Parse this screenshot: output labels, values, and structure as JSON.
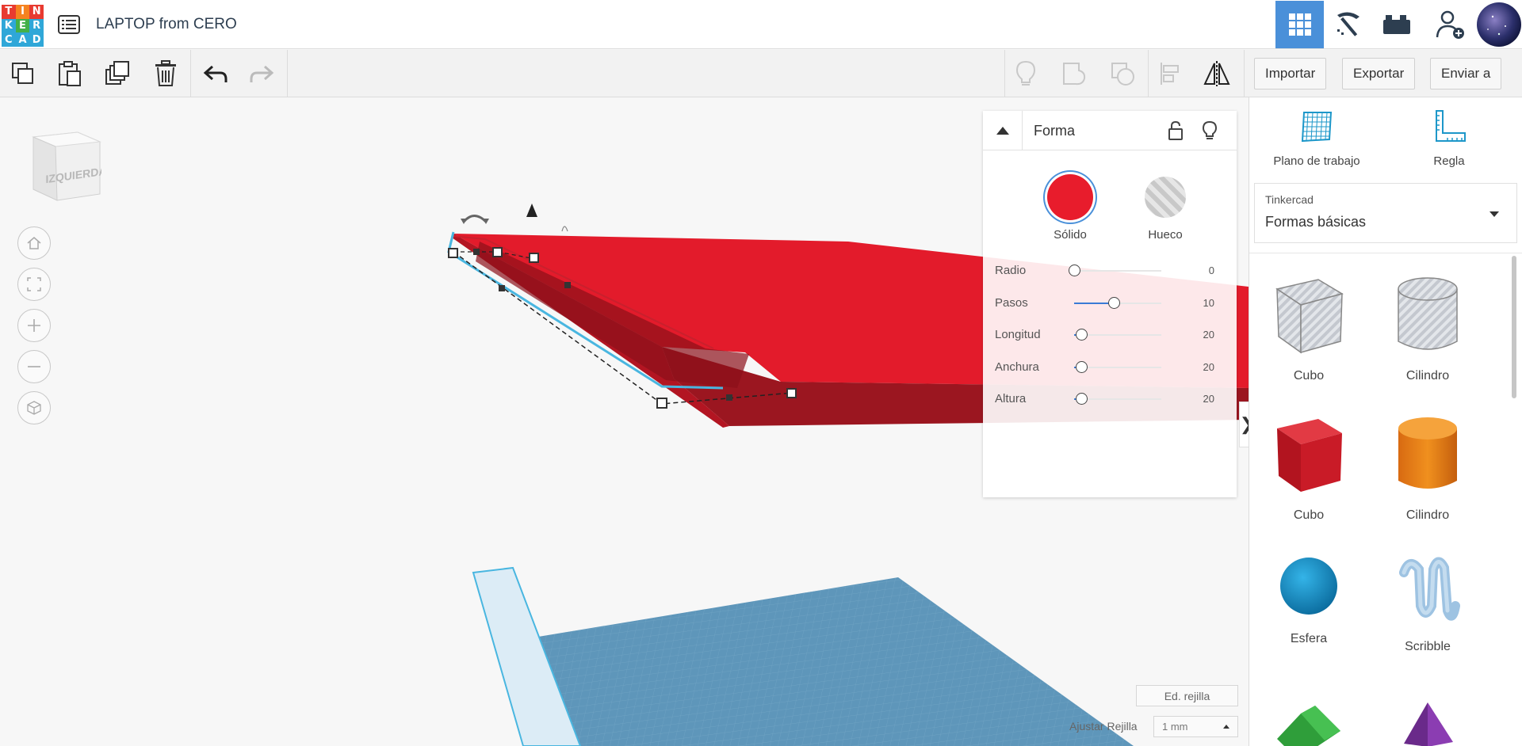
{
  "app": {
    "logo_letters": [
      "T",
      "I",
      "N",
      "K",
      "E",
      "R",
      "C",
      "A",
      "D"
    ],
    "logo_colors": [
      "#e83a30",
      "#f58220",
      "#e83a30",
      "#2fa7d8",
      "#43b049",
      "#2fa7d8",
      "#2fa7d8",
      "#2fa7d8",
      "#2fa7d8"
    ],
    "design_title": "LAPTOP from CERO",
    "design_list_icon": "list-icon",
    "top_right": [
      {
        "name": "3d-design-view-button",
        "icon": "grid-icon",
        "active": true
      },
      {
        "name": "codeblocks-button",
        "icon": "pickaxe-icon",
        "active": false
      },
      {
        "name": "bricks-button",
        "icon": "brick-icon",
        "active": false
      },
      {
        "name": "add-user-button",
        "icon": "user-plus-icon",
        "active": false
      },
      {
        "name": "profile-avatar",
        "icon": "avatar-icon",
        "active": false
      }
    ]
  },
  "toolbar": {
    "left_tools": [
      {
        "name": "copy-button",
        "icon": "copy-icon"
      },
      {
        "name": "paste-button",
        "icon": "paste-icon"
      },
      {
        "name": "duplicate-button",
        "icon": "duplicate-icon"
      },
      {
        "name": "delete-button",
        "icon": "trash-icon"
      },
      {
        "name": "undo-button",
        "icon": "undo-icon"
      },
      {
        "name": "redo-button",
        "icon": "redo-icon"
      }
    ],
    "right_tools": [
      {
        "name": "notes-button",
        "icon": "lightbulb-icon"
      },
      {
        "name": "group-button",
        "icon": "group-icon"
      },
      {
        "name": "ungroup-button",
        "icon": "ungroup-icon"
      },
      {
        "name": "align-button",
        "icon": "align-icon"
      },
      {
        "name": "mirror-button",
        "icon": "mirror-icon"
      }
    ],
    "import_label": "Importar",
    "export_label": "Exportar",
    "send_label": "Enviar a"
  },
  "view_cube": {
    "face_label": "IZQUIERDA"
  },
  "nav_controls": [
    {
      "name": "home-view-button",
      "icon": "home-icon"
    },
    {
      "name": "fit-view-button",
      "icon": "fit-icon"
    },
    {
      "name": "zoom-in-button",
      "icon": "plus-icon"
    },
    {
      "name": "zoom-out-button",
      "icon": "minus-icon"
    },
    {
      "name": "perspective-button",
      "icon": "cube-outline-icon"
    }
  ],
  "inspector": {
    "title": "Forma",
    "lock_icon": "unlock-icon",
    "light_icon": "lightbulb-icon",
    "solid_label": "Sólido",
    "hole_label": "Hueco",
    "solid_color": "#e81c2c",
    "params": [
      {
        "label": "Radio",
        "value": "0",
        "fraction": 0.0
      },
      {
        "label": "Pasos",
        "value": "10",
        "fraction": 0.45
      },
      {
        "label": "Longitud",
        "value": "20",
        "fraction": 0.08
      },
      {
        "label": "Anchura",
        "value": "20",
        "fraction": 0.08
      },
      {
        "label": "Altura",
        "value": "20",
        "fraction": 0.08
      }
    ]
  },
  "panel_toggle_glyph": "❯",
  "grid": {
    "edit_label": "Ed. rejilla",
    "snap_label": "Ajustar Rejilla",
    "snap_value": "1 mm"
  },
  "right_panel": {
    "workplane_label": "Plano de trabajo",
    "ruler_label": "Regla",
    "library_source": "Tinkercad",
    "library_category": "Formas básicas",
    "shapes": [
      {
        "label": "Cubo",
        "kind": "cube-hole"
      },
      {
        "label": "Cilindro",
        "kind": "cylinder-hole"
      },
      {
        "label": "Cubo",
        "kind": "cube"
      },
      {
        "label": "Cilindro",
        "kind": "cylinder"
      },
      {
        "label": "Esfera",
        "kind": "sphere"
      },
      {
        "label": "Scribble",
        "kind": "scribble"
      },
      {
        "label": "",
        "kind": "roof"
      },
      {
        "label": "",
        "kind": "pyramid"
      }
    ]
  },
  "colors": {
    "accent_blue": "#4a90d9",
    "shape_red": "#e81c2c",
    "workplane_blue": "#5a93b8"
  }
}
